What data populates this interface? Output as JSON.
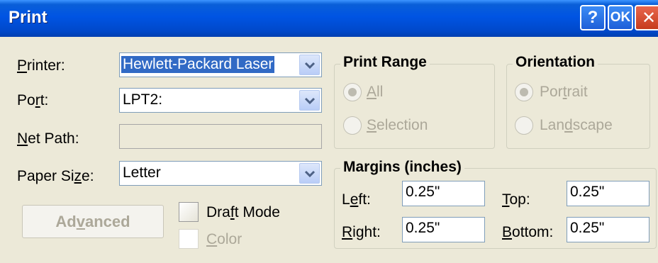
{
  "window": {
    "title": "Print",
    "help_label": "?",
    "ok_label": "OK",
    "close_label": "✕"
  },
  "printer": {
    "label_pre": "",
    "label_u": "P",
    "label_post": "rinter:",
    "value": "Hewlett-Packard Laser"
  },
  "port": {
    "label_pre": "Po",
    "label_u": "r",
    "label_post": "t:",
    "value": "LPT2:"
  },
  "net_path": {
    "label_pre": "",
    "label_u": "N",
    "label_post": "et Path:",
    "value": ""
  },
  "paper_size": {
    "label_pre": "Paper Si",
    "label_u": "z",
    "label_post": "e:",
    "value": "Letter"
  },
  "advanced": {
    "label_pre": "Ad",
    "label_u": "v",
    "label_post": "anced"
  },
  "draft_mode": {
    "label_pre": "Dra",
    "label_u": "f",
    "label_post": "t Mode",
    "checked": false
  },
  "color": {
    "label_pre": "",
    "label_u": "C",
    "label_post": "olor",
    "checked": false
  },
  "print_range": {
    "title": "Print Range",
    "all": {
      "label_pre": "",
      "label_u": "A",
      "label_post": "ll",
      "checked": true
    },
    "selection": {
      "label_pre": "",
      "label_u": "S",
      "label_post": "election",
      "checked": false
    }
  },
  "orientation": {
    "title": "Orientation",
    "portrait": {
      "label_pre": "Por",
      "label_u": "t",
      "label_post": "rait",
      "checked": true
    },
    "landscape": {
      "label_pre": "Lan",
      "label_u": "d",
      "label_post": "scape",
      "checked": false
    }
  },
  "margins": {
    "title": "Margins (inches)",
    "left": {
      "label_pre": "L",
      "label_u": "e",
      "label_post": "ft:",
      "value": "0.25\""
    },
    "top": {
      "label_pre": "",
      "label_u": "T",
      "label_post": "op:",
      "value": "0.25\""
    },
    "right": {
      "label_pre": "",
      "label_u": "R",
      "label_post": "ight:",
      "value": "0.25\""
    },
    "bottom": {
      "label_pre": "",
      "label_u": "B",
      "label_post": "ottom:",
      "value": "0.25\""
    }
  },
  "colors": {
    "titlebar": "#0054e3",
    "dialog_bg": "#ece9d8",
    "selection_bg": "#316ac5",
    "disabled_text": "#aca899"
  }
}
